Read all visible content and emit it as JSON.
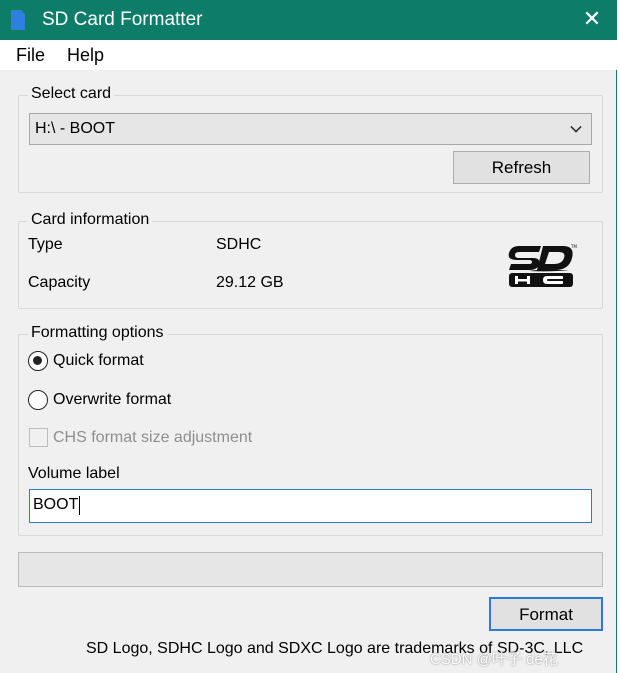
{
  "window": {
    "title": "SD Card Formatter",
    "close_glyph": "✕",
    "app_icon": "sd-card-icon",
    "accent_color": "#0d7d6a"
  },
  "menu": {
    "items": [
      "File",
      "Help"
    ]
  },
  "select_card": {
    "group_title": "Select card",
    "selected_card": "H:\\ - BOOT",
    "refresh_label": "Refresh"
  },
  "card_info": {
    "group_title": "Card information",
    "type_label": "Type",
    "type_value": "SDHC",
    "capacity_label": "Capacity",
    "capacity_value": "29.12 GB",
    "logo": "sdhc-logo"
  },
  "formatting": {
    "group_title": "Formatting options",
    "quick_format_label": "Quick format",
    "quick_format_selected": true,
    "overwrite_format_label": "Overwrite format",
    "overwrite_format_selected": false,
    "chs_label": "CHS format size adjustment",
    "chs_checked": false,
    "chs_enabled": false,
    "volume_label_caption": "Volume label",
    "volume_label_value": "BOOT"
  },
  "progress": {
    "fraction": 0
  },
  "actions": {
    "format_label": "Format"
  },
  "footer": {
    "trademark_text": "SD Logo, SDHC Logo and SDXC Logo are trademarks of SD-3C, LLC",
    "watermark": "CSDN @叶子 de花"
  }
}
